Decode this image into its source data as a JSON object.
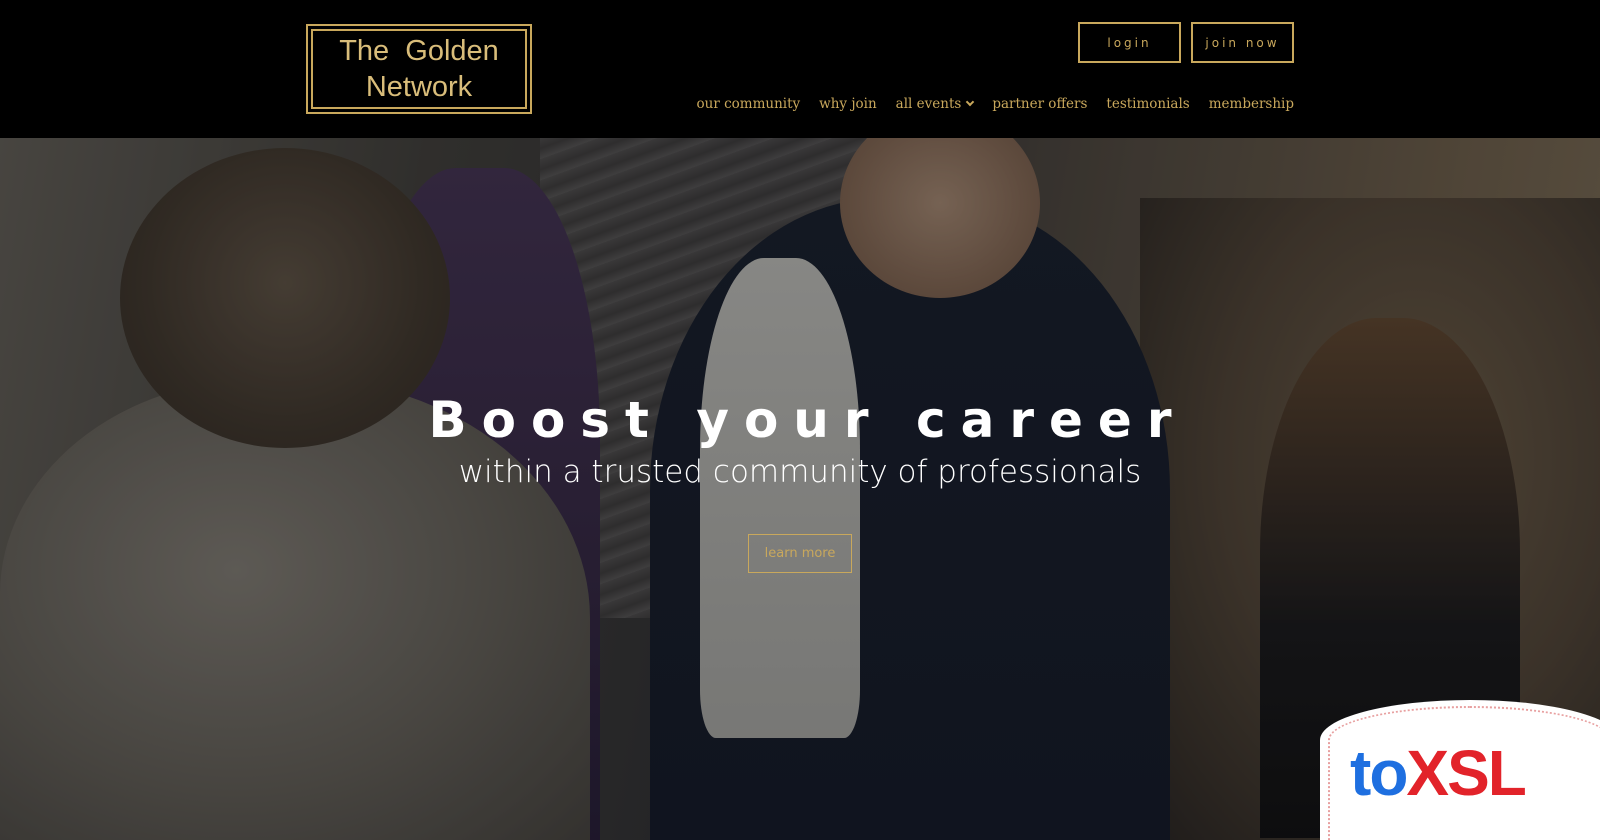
{
  "logo": {
    "line1": "The  Golden",
    "line2": "Network"
  },
  "top_buttons": {
    "login": "login",
    "join": "join now"
  },
  "nav": {
    "items": [
      {
        "label": "our community"
      },
      {
        "label": "why join"
      },
      {
        "label": "all events"
      },
      {
        "label": "partner offers"
      },
      {
        "label": "testimonials"
      },
      {
        "label": "membership"
      }
    ]
  },
  "hero": {
    "title": "Boost your career",
    "subtitle": "within a trusted community of professionals",
    "cta": "learn more"
  },
  "badge": {
    "part1": "to",
    "part2": "XSL"
  },
  "colors": {
    "gold": "#c9a85c",
    "header_bg": "#000000"
  },
  "icons": {
    "dropdown": "chevron-down-icon"
  }
}
